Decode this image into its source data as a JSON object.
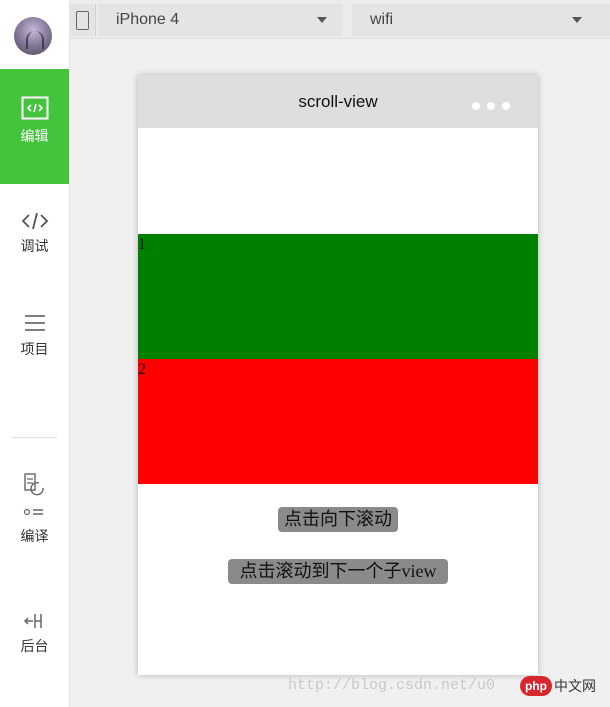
{
  "sidebar": {
    "items": [
      {
        "label": "编辑",
        "icon": "code-box-icon",
        "active": true
      },
      {
        "label": "调试",
        "icon": "code-brackets-icon"
      },
      {
        "label": "项目",
        "icon": "menu-icon"
      },
      {
        "label": "编译",
        "icon": "compile-icon"
      },
      {
        "label": "后台",
        "icon": "backend-icon"
      }
    ],
    "colors": {
      "active_bg": "#44c33c"
    }
  },
  "toolbar": {
    "device": "iPhone 4",
    "network": "wifi"
  },
  "simulator": {
    "title": "scroll-view",
    "scroll_items": [
      {
        "label": "1",
        "color": "#008000"
      },
      {
        "label": "2",
        "color": "#ff0000"
      }
    ],
    "buttons": {
      "scroll_down": "点击向下滚动",
      "scroll_next_view": "点击滚动到下一个子view"
    }
  },
  "watermark": {
    "url": "http://blog.csdn.net/u0",
    "badge": "php",
    "site": "中文网"
  }
}
